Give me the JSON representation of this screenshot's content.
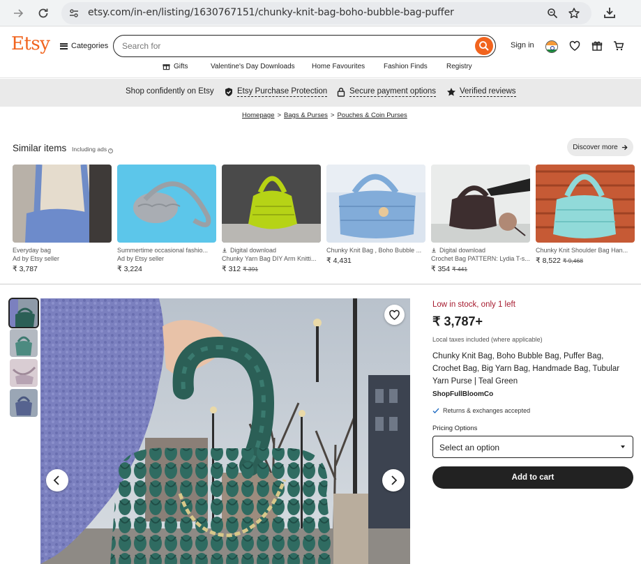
{
  "browser": {
    "url": "etsy.com/in-en/listing/1630767151/chunky-knit-bag-boho-bubble-bag-puffer",
    "icons": [
      "forward-icon",
      "reload-icon",
      "site-info-icon",
      "zoom-icon",
      "bookmark-star-icon",
      "download-icon"
    ]
  },
  "header": {
    "logo": "Etsy",
    "categories_label": "Categories",
    "search_placeholder": "Search for",
    "sign_in": "Sign in",
    "subnav": [
      "Gifts",
      "Valentine's Day Downloads",
      "Home Favourites",
      "Fashion Finds",
      "Registry"
    ]
  },
  "trust": {
    "lead": "Shop confidently on Etsy",
    "items": [
      "Etsy Purchase Protection",
      "Secure payment options",
      "Verified reviews"
    ]
  },
  "breadcrumb": [
    "Homepage",
    "Bags & Purses",
    "Pouches & Coin Purses"
  ],
  "similar": {
    "title": "Similar items",
    "subtitle": "Including ads",
    "discover_label": "Discover more",
    "cards": [
      {
        "line1": "Everyday bag",
        "line2": "Ad by Etsy seller",
        "price": "₹ 3,787",
        "old": ""
      },
      {
        "line1": "Summertime occasional fashio...",
        "line2": "Ad by Etsy seller",
        "price": "₹ 3,224",
        "old": ""
      },
      {
        "line1": "Digital download",
        "line2": "Chunky Yarn Bag DIY Arm Knitti...",
        "price": "₹ 312",
        "old": "₹ 391"
      },
      {
        "line1": "Chunky Knit Bag , Boho Bubble ...",
        "line2": "",
        "price": "₹ 4,431",
        "old": ""
      },
      {
        "line1": "Digital download",
        "line2": "Crochet Bag PATTERN: Lydia T-s...",
        "price": "₹ 354",
        "old": "₹ 441"
      },
      {
        "line1": "Chunky Knit Shoulder Bag Han...",
        "line2": "",
        "price": "₹ 8,522",
        "old": "₹ 9,468"
      }
    ]
  },
  "listing": {
    "stock": "Low in stock, only 1 left",
    "price": "₹ 3,787+",
    "tax_note": "Local taxes included (where applicable)",
    "title": "Chunky Knit Bag, Boho Bubble Bag, Puffer Bag, Crochet Bag, Big Yarn Bag, Handmade Bag, Tubular Yarn Purse | Teal Green",
    "shop": "ShopFullBloomCo",
    "returns": "Returns & exchanges accepted",
    "pricing_label": "Pricing Options",
    "select_value": "Select an option",
    "add_to_cart": "Add to cart"
  },
  "colors": {
    "brand": "#f1641e",
    "stock_red": "#a61a2e",
    "bag_teal": "#2b5f56"
  }
}
